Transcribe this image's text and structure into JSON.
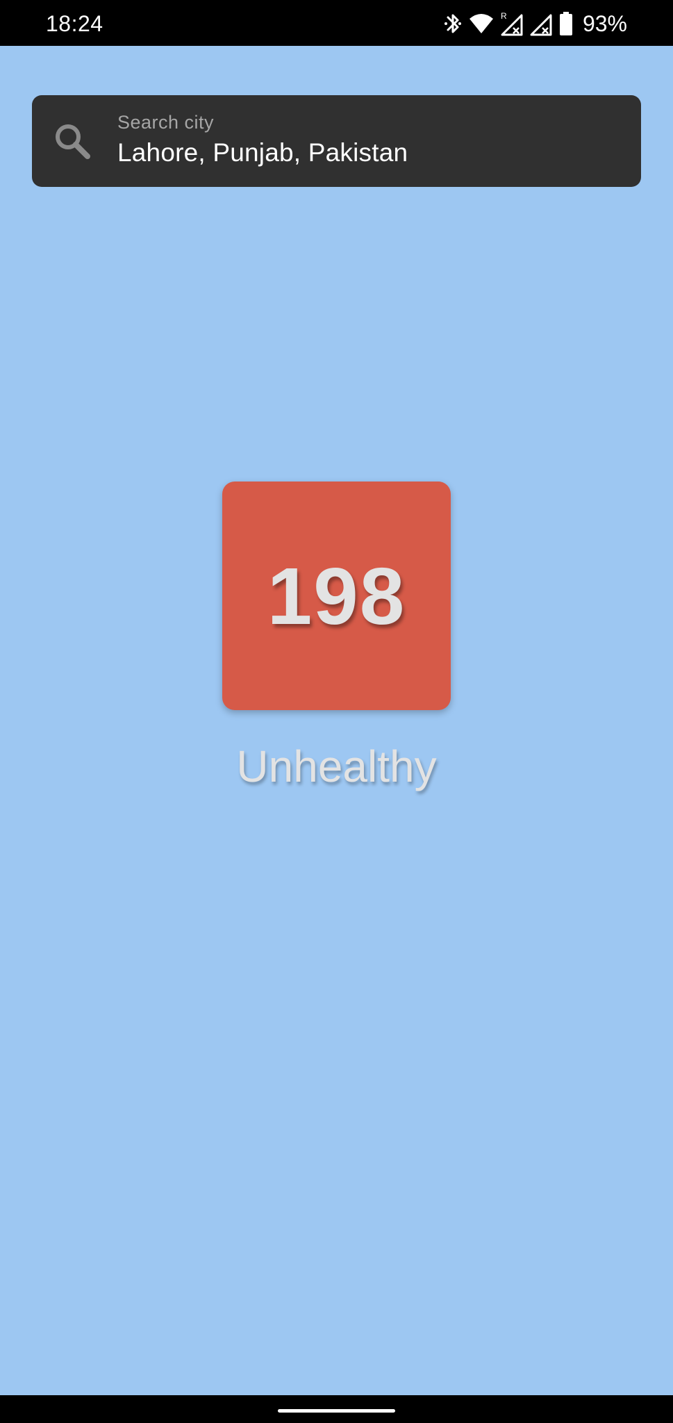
{
  "status_bar": {
    "time": "18:24",
    "battery_percent": "93%",
    "icons": [
      "bluetooth-icon",
      "wifi-icon",
      "signal-roaming-icon",
      "signal-icon",
      "battery-icon"
    ],
    "roaming_marker": "R"
  },
  "search": {
    "label": "Search city",
    "value": "Lahore, Punjab, Pakistan",
    "icon": "search-icon"
  },
  "aqi": {
    "value": "198",
    "category": "Unhealthy",
    "tile_color": "#d65a48"
  },
  "theme": {
    "background": "#9dc7f2",
    "search_bar_background": "#303030"
  }
}
